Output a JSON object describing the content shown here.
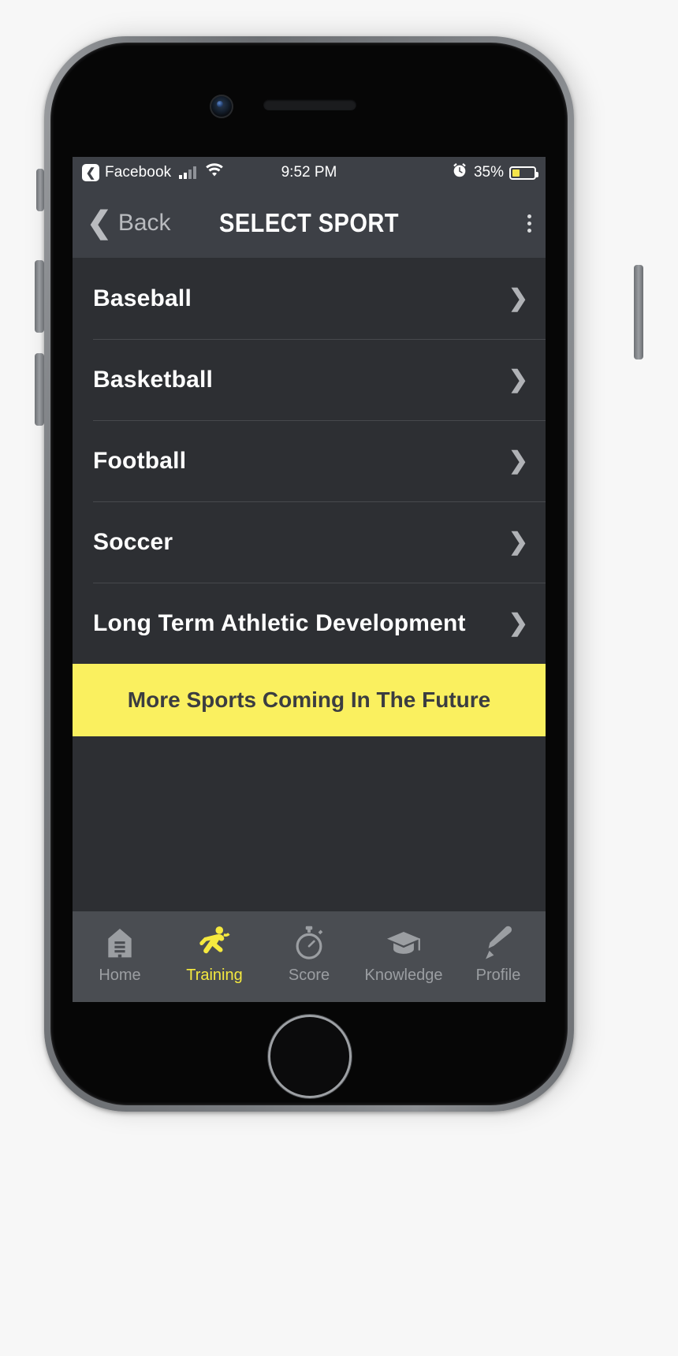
{
  "device": {
    "name": "iphone-mockup",
    "home_button": "home-button"
  },
  "status_bar": {
    "back_app": "Facebook",
    "back_glyph": "❮",
    "time": "9:52 PM",
    "battery_percent": "35%",
    "battery_level": 35,
    "alarm_icon": "alarm-clock-icon",
    "signal_icon": "cellular-signal-icon",
    "wifi_icon": "wifi-icon",
    "battery_icon": "battery-icon",
    "colors": {
      "bar_bg": "#3d4046",
      "text": "#ffffff",
      "battery_fill": "#f4e44a"
    }
  },
  "nav_bar": {
    "back_label": "Back",
    "back_chevron": "❮",
    "title": "SELECT SPORT",
    "menu_icon": "kebab-menu-icon",
    "colors": {
      "bg": "#3d4046",
      "title": "#ffffff",
      "back": "#b9bbbf"
    }
  },
  "sports_list": {
    "chevron": "❯",
    "items": [
      {
        "label": "Baseball"
      },
      {
        "label": "Basketball"
      },
      {
        "label": "Football"
      },
      {
        "label": "Soccer"
      },
      {
        "label": "Long Term Athletic Development"
      }
    ]
  },
  "banner": {
    "text": "More Sports Coming In The Future",
    "bg": "#faf05f",
    "text_color": "#3b3d41"
  },
  "tab_bar": {
    "active_color": "#f5e93f",
    "inactive_color": "#9b9ea2",
    "bg": "#4a4d52",
    "tabs": [
      {
        "label": "Home",
        "icon": "home-icon",
        "active": false
      },
      {
        "label": "Training",
        "icon": "running-athlete-icon",
        "active": true
      },
      {
        "label": "Score",
        "icon": "stopwatch-icon",
        "active": false
      },
      {
        "label": "Knowledge",
        "icon": "graduation-cap-icon",
        "active": false
      },
      {
        "label": "Profile",
        "icon": "pencil-icon",
        "active": false
      }
    ]
  }
}
